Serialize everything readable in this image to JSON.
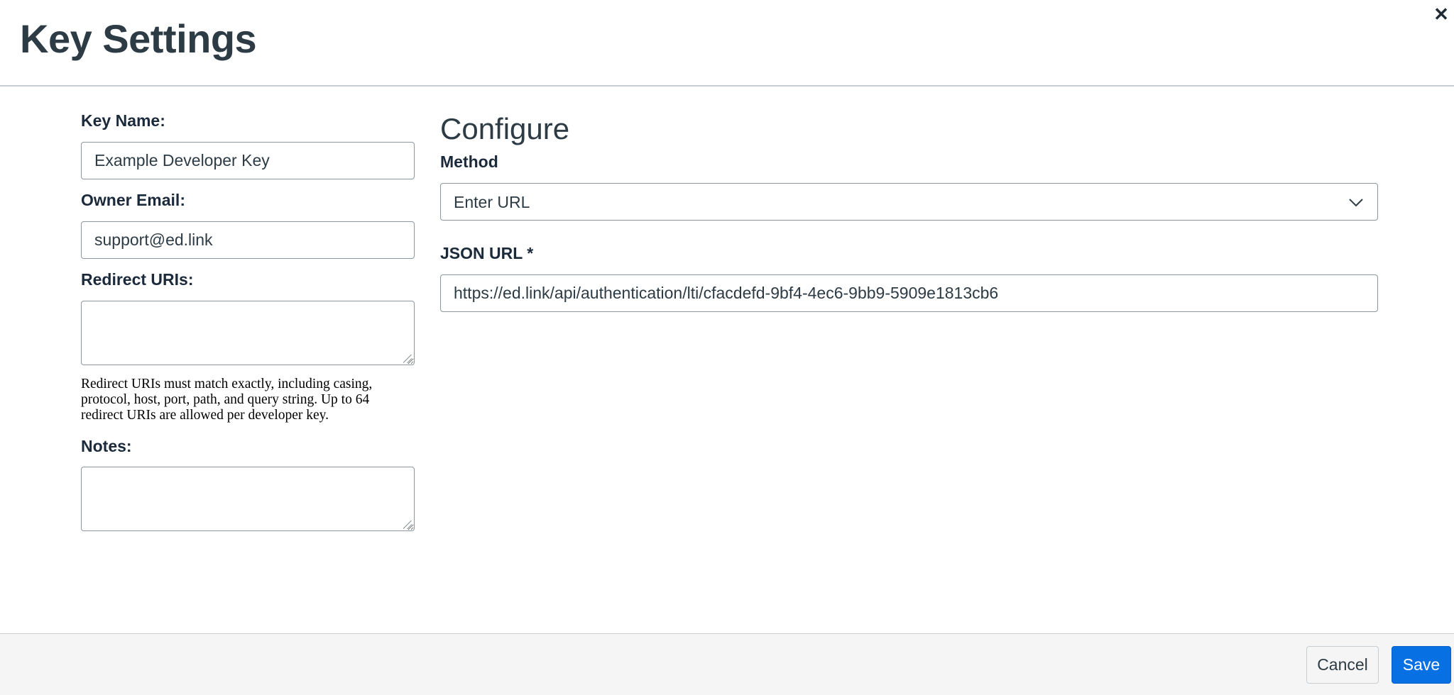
{
  "header": {
    "title": "Key Settings",
    "close_glyph": "✕"
  },
  "form": {
    "key_name_label": "Key Name:",
    "key_name_value": "Example Developer Key",
    "owner_email_label": "Owner Email:",
    "owner_email_value": "support@ed.link",
    "redirect_uris_label": "Redirect URIs:",
    "redirect_uris_value": "",
    "redirect_uris_help": "Redirect URIs must match exactly, including casing, protocol, host, port, path, and query string. Up to 64 redirect URIs are allowed per developer key.",
    "notes_label": "Notes:",
    "notes_value": ""
  },
  "configure": {
    "title": "Configure",
    "method_label": "Method",
    "method_selected": "Enter URL",
    "json_url_label": "JSON URL *",
    "json_url_value": "https://ed.link/api/authentication/lti/cfacdefd-9bf4-4ec6-9bb9-5909e1813cb6"
  },
  "footer": {
    "cancel_label": "Cancel",
    "save_label": "Save"
  },
  "colors": {
    "primary": "#0770e3",
    "text": "#2d3b45",
    "border": "#8b969e",
    "footer_bg": "#f5f5f5"
  }
}
